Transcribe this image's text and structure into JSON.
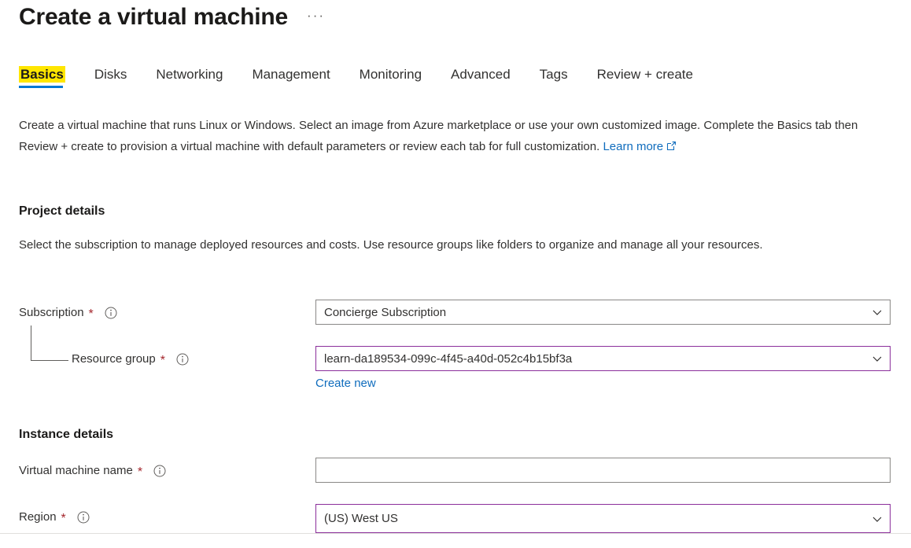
{
  "header": {
    "title": "Create a virtual machine",
    "more_menu": "···"
  },
  "tabs": [
    {
      "label": "Basics",
      "selected": true
    },
    {
      "label": "Disks",
      "selected": false
    },
    {
      "label": "Networking",
      "selected": false
    },
    {
      "label": "Management",
      "selected": false
    },
    {
      "label": "Monitoring",
      "selected": false
    },
    {
      "label": "Advanced",
      "selected": false
    },
    {
      "label": "Tags",
      "selected": false
    },
    {
      "label": "Review + create",
      "selected": false
    }
  ],
  "description": {
    "text": "Create a virtual machine that runs Linux or Windows. Select an image from Azure marketplace or use your own customized image. Complete the Basics tab then Review + create to provision a virtual machine with default parameters or review each tab for full customization. ",
    "link_label": "Learn more"
  },
  "project_details": {
    "heading": "Project details",
    "subtext": "Select the subscription to manage deployed resources and costs. Use resource groups like folders to organize and manage all your resources.",
    "subscription": {
      "label": "Subscription",
      "required": "*",
      "value": "Concierge Subscription"
    },
    "resource_group": {
      "label": "Resource group",
      "required": "*",
      "value": "learn-da189534-099c-4f45-a40d-052c4b15bf3a",
      "create_new_label": "Create new"
    }
  },
  "instance_details": {
    "heading": "Instance details",
    "vm_name": {
      "label": "Virtual machine name",
      "required": "*",
      "value": "",
      "placeholder": ""
    },
    "region": {
      "label": "Region",
      "required": "*",
      "value": "(US) West US"
    }
  },
  "colors": {
    "accent_blue": "#0078d4",
    "link_blue": "#0f6cbd",
    "highlight_yellow": "#ffe600",
    "required_red": "#a4262c",
    "focus_purple": "#8b2f9b",
    "border_gray": "#8a8886",
    "text": "#323130"
  }
}
